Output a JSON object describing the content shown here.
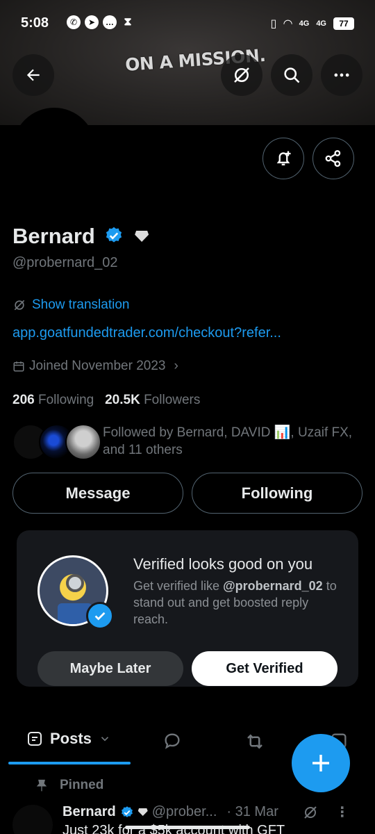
{
  "status_bar": {
    "time": "5:08",
    "network1": "4G",
    "network2": "4G",
    "battery": "77"
  },
  "banner": {
    "text": "ON A MISSION."
  },
  "profile": {
    "name": "Bernard",
    "handle": "@probernard_02",
    "translate_label": "Show translation",
    "link": "app.goatfundedtrader.com/checkout?refer...",
    "joined": "Joined November 2023",
    "following_count": "206",
    "following_label": "Following",
    "followers_count": "20.5K",
    "followers_label": "Followers",
    "followed_by": "Followed by Bernard, DAVID 📊, Uzaif FX, and 11 others"
  },
  "actions": {
    "message": "Message",
    "following": "Following"
  },
  "verified_card": {
    "title": "Verified looks good on you",
    "body_prefix": "Get verified like",
    "body_handle": "@probernard_02",
    "body_suffix": "to stand out and get boosted reply reach.",
    "maybe_later": "Maybe Later",
    "get_verified": "Get Verified"
  },
  "tabs": {
    "posts": "Posts"
  },
  "pinned_post": {
    "pinned_label": "Pinned",
    "name": "Bernard",
    "handle": "@prober...",
    "date": "· 31 Mar",
    "text": "Just 23k for a $5k account with GFT"
  },
  "colors": {
    "accent": "#1d9bf0",
    "background": "#000000",
    "card": "#16181c"
  }
}
